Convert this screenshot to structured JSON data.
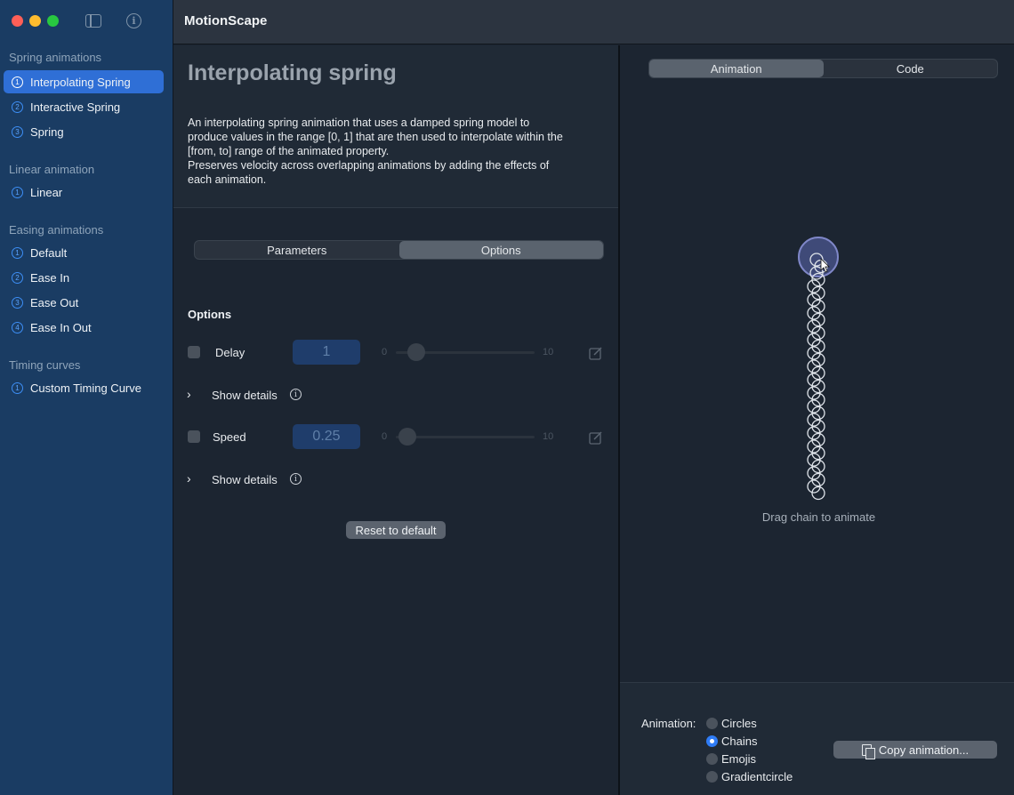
{
  "app": {
    "title": "MotionScape"
  },
  "sidebar": {
    "sections": [
      {
        "title": "Spring animations",
        "items": [
          {
            "num": "1",
            "label": "Interpolating Spring",
            "active": true
          },
          {
            "num": "2",
            "label": "Interactive Spring"
          },
          {
            "num": "3",
            "label": "Spring"
          }
        ]
      },
      {
        "title": "Linear animation",
        "items": [
          {
            "num": "1",
            "label": "Linear"
          }
        ]
      },
      {
        "title": "Easing animations",
        "items": [
          {
            "num": "1",
            "label": "Default"
          },
          {
            "num": "2",
            "label": "Ease In"
          },
          {
            "num": "3",
            "label": "Ease Out"
          },
          {
            "num": "4",
            "label": "Ease In Out"
          }
        ]
      },
      {
        "title": "Timing curves",
        "items": [
          {
            "num": "1",
            "label": "Custom Timing Curve"
          }
        ]
      }
    ]
  },
  "main": {
    "title": "Interpolating spring",
    "description": [
      "An interpolating spring animation that uses a damped spring model to",
      "produce values in the range [0, 1] that are then used to interpolate within the",
      "[from, to] range of the animated property.",
      "Preserves velocity across overlapping animations by adding the effects of",
      "each animation."
    ],
    "tabs": [
      "Parameters",
      "Options"
    ],
    "selected_tab": "Options",
    "options_heading": "Options",
    "rows": [
      {
        "label": "Delay",
        "value": "1",
        "min": "0",
        "max": "10",
        "slider_fraction": 0.1,
        "checked": false
      },
      {
        "label": "Speed",
        "value": "0.25",
        "min": "0",
        "max": "10",
        "slider_fraction": 0.025,
        "checked": false
      }
    ],
    "show_details": "Show details",
    "reset_label": "Reset to default"
  },
  "preview": {
    "tabs": [
      "Animation",
      "Code"
    ],
    "selected_tab": "Animation",
    "drag_hint": "Drag chain to animate",
    "animation_label": "Animation:",
    "animation_options": [
      "Circles",
      "Chains",
      "Emojis",
      "Gradientcircle"
    ],
    "selected_animation": "Chains",
    "copy_label": "Copy animation..."
  },
  "colors": {
    "accent": "#2f6fd6",
    "sidebar_bg": "#1a3c63",
    "pane_bg": "#1c2531"
  },
  "icons": {
    "sidebar_toggle": "sidebar-toggle-icon",
    "info": "info-icon",
    "edit": "edit-icon",
    "chevron": "chevron-right-icon",
    "copy": "document-copy-icon"
  }
}
